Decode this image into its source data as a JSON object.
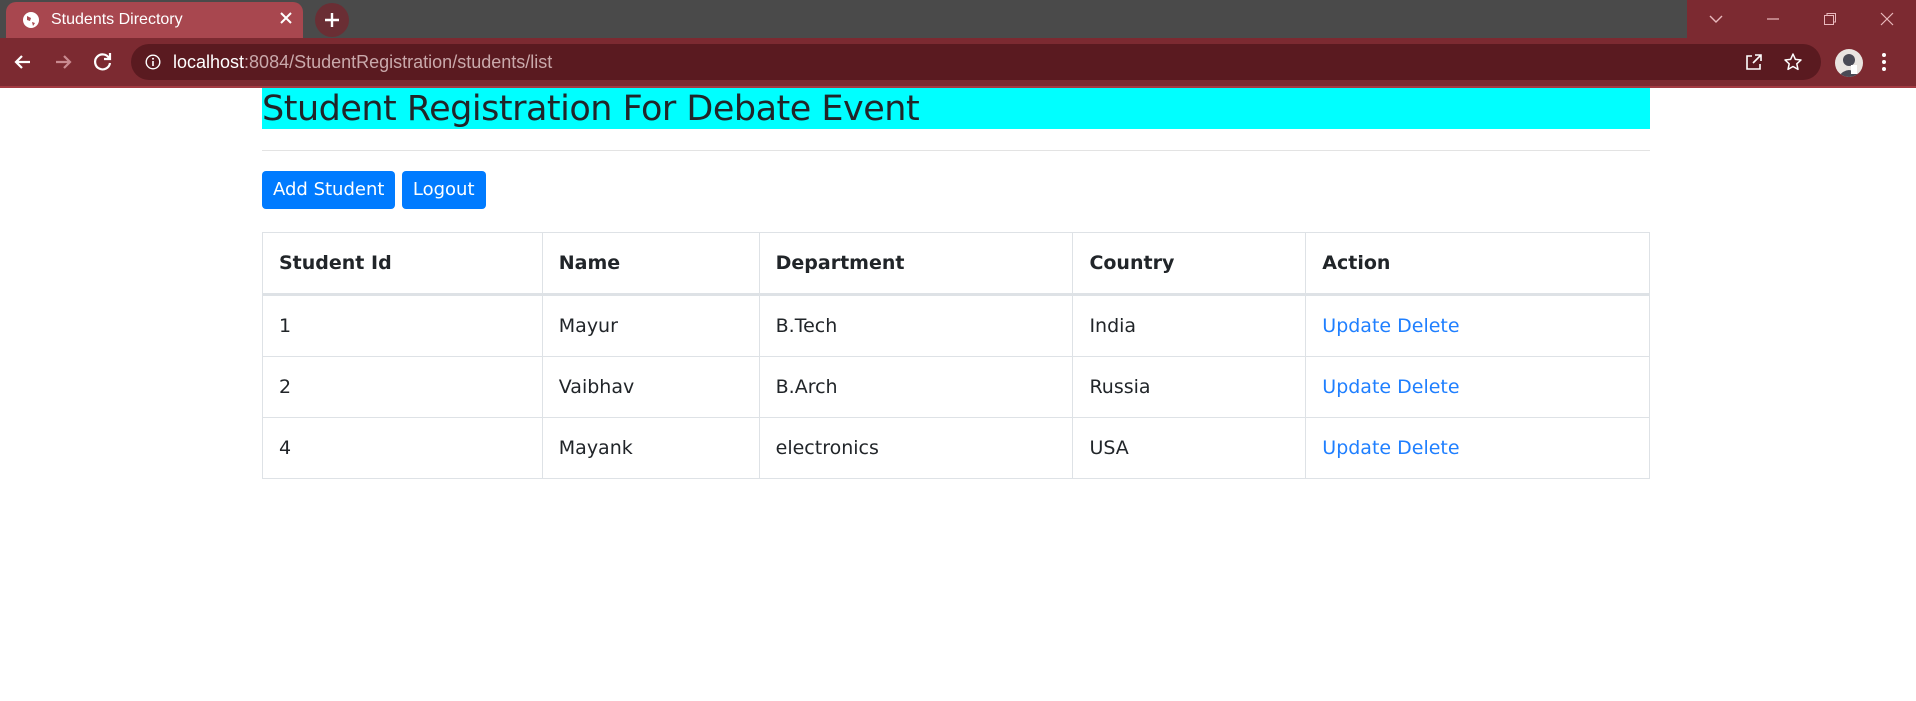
{
  "browser": {
    "tab_title": "Students Directory",
    "url_host": "localhost",
    "url_rest": ":8084/StudentRegistration/students/list"
  },
  "page": {
    "title": "Student Registration For Debate Event",
    "add_button": "Add Student",
    "logout_button": "Logout"
  },
  "table": {
    "headers": [
      "Student Id",
      "Name",
      "Department",
      "Country",
      "Action"
    ],
    "rows": [
      {
        "id": "1",
        "name": "Mayur",
        "department": "B.Tech",
        "country": "India",
        "update": "Update",
        "delete": "Delete"
      },
      {
        "id": "2",
        "name": "Vaibhav",
        "department": "B.Arch",
        "country": "Russia",
        "update": "Update",
        "delete": "Delete"
      },
      {
        "id": "4",
        "name": "Mayank",
        "department": "electronics",
        "country": "USA",
        "update": "Update",
        "delete": "Delete"
      }
    ]
  },
  "colors": {
    "title_bg": "#00ffff",
    "primary": "#007bff",
    "link": "#1f7fff",
    "chrome": "#7c2a31"
  },
  "icons": [
    "globe-icon",
    "close-icon",
    "plus-icon",
    "back-icon",
    "forward-icon",
    "reload-icon",
    "info-icon",
    "share-icon",
    "star-icon",
    "menu-icon"
  ]
}
